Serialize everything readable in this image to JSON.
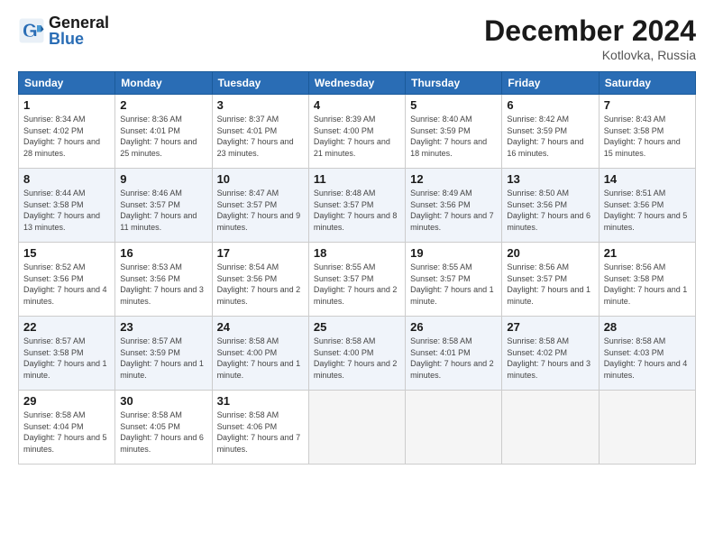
{
  "header": {
    "logo_general": "General",
    "logo_blue": "Blue",
    "month": "December 2024",
    "location": "Kotlovka, Russia"
  },
  "days_of_week": [
    "Sunday",
    "Monday",
    "Tuesday",
    "Wednesday",
    "Thursday",
    "Friday",
    "Saturday"
  ],
  "weeks": [
    {
      "shaded": false,
      "days": [
        {
          "date": "1",
          "sunrise": "8:34 AM",
          "sunset": "4:02 PM",
          "daylight": "7 hours and 28 minutes."
        },
        {
          "date": "2",
          "sunrise": "8:36 AM",
          "sunset": "4:01 PM",
          "daylight": "7 hours and 25 minutes."
        },
        {
          "date": "3",
          "sunrise": "8:37 AM",
          "sunset": "4:01 PM",
          "daylight": "7 hours and 23 minutes."
        },
        {
          "date": "4",
          "sunrise": "8:39 AM",
          "sunset": "4:00 PM",
          "daylight": "7 hours and 21 minutes."
        },
        {
          "date": "5",
          "sunrise": "8:40 AM",
          "sunset": "3:59 PM",
          "daylight": "7 hours and 18 minutes."
        },
        {
          "date": "6",
          "sunrise": "8:42 AM",
          "sunset": "3:59 PM",
          "daylight": "7 hours and 16 minutes."
        },
        {
          "date": "7",
          "sunrise": "8:43 AM",
          "sunset": "3:58 PM",
          "daylight": "7 hours and 15 minutes."
        }
      ]
    },
    {
      "shaded": true,
      "days": [
        {
          "date": "8",
          "sunrise": "8:44 AM",
          "sunset": "3:58 PM",
          "daylight": "7 hours and 13 minutes."
        },
        {
          "date": "9",
          "sunrise": "8:46 AM",
          "sunset": "3:57 PM",
          "daylight": "7 hours and 11 minutes."
        },
        {
          "date": "10",
          "sunrise": "8:47 AM",
          "sunset": "3:57 PM",
          "daylight": "7 hours and 9 minutes."
        },
        {
          "date": "11",
          "sunrise": "8:48 AM",
          "sunset": "3:57 PM",
          "daylight": "7 hours and 8 minutes."
        },
        {
          "date": "12",
          "sunrise": "8:49 AM",
          "sunset": "3:56 PM",
          "daylight": "7 hours and 7 minutes."
        },
        {
          "date": "13",
          "sunrise": "8:50 AM",
          "sunset": "3:56 PM",
          "daylight": "7 hours and 6 minutes."
        },
        {
          "date": "14",
          "sunrise": "8:51 AM",
          "sunset": "3:56 PM",
          "daylight": "7 hours and 5 minutes."
        }
      ]
    },
    {
      "shaded": false,
      "days": [
        {
          "date": "15",
          "sunrise": "8:52 AM",
          "sunset": "3:56 PM",
          "daylight": "7 hours and 4 minutes."
        },
        {
          "date": "16",
          "sunrise": "8:53 AM",
          "sunset": "3:56 PM",
          "daylight": "7 hours and 3 minutes."
        },
        {
          "date": "17",
          "sunrise": "8:54 AM",
          "sunset": "3:56 PM",
          "daylight": "7 hours and 2 minutes."
        },
        {
          "date": "18",
          "sunrise": "8:55 AM",
          "sunset": "3:57 PM",
          "daylight": "7 hours and 2 minutes."
        },
        {
          "date": "19",
          "sunrise": "8:55 AM",
          "sunset": "3:57 PM",
          "daylight": "7 hours and 1 minute."
        },
        {
          "date": "20",
          "sunrise": "8:56 AM",
          "sunset": "3:57 PM",
          "daylight": "7 hours and 1 minute."
        },
        {
          "date": "21",
          "sunrise": "8:56 AM",
          "sunset": "3:58 PM",
          "daylight": "7 hours and 1 minute."
        }
      ]
    },
    {
      "shaded": true,
      "days": [
        {
          "date": "22",
          "sunrise": "8:57 AM",
          "sunset": "3:58 PM",
          "daylight": "7 hours and 1 minute."
        },
        {
          "date": "23",
          "sunrise": "8:57 AM",
          "sunset": "3:59 PM",
          "daylight": "7 hours and 1 minute."
        },
        {
          "date": "24",
          "sunrise": "8:58 AM",
          "sunset": "4:00 PM",
          "daylight": "7 hours and 1 minute."
        },
        {
          "date": "25",
          "sunrise": "8:58 AM",
          "sunset": "4:00 PM",
          "daylight": "7 hours and 2 minutes."
        },
        {
          "date": "26",
          "sunrise": "8:58 AM",
          "sunset": "4:01 PM",
          "daylight": "7 hours and 2 minutes."
        },
        {
          "date": "27",
          "sunrise": "8:58 AM",
          "sunset": "4:02 PM",
          "daylight": "7 hours and 3 minutes."
        },
        {
          "date": "28",
          "sunrise": "8:58 AM",
          "sunset": "4:03 PM",
          "daylight": "7 hours and 4 minutes."
        }
      ]
    },
    {
      "shaded": false,
      "days": [
        {
          "date": "29",
          "sunrise": "8:58 AM",
          "sunset": "4:04 PM",
          "daylight": "7 hours and 5 minutes."
        },
        {
          "date": "30",
          "sunrise": "8:58 AM",
          "sunset": "4:05 PM",
          "daylight": "7 hours and 6 minutes."
        },
        {
          "date": "31",
          "sunrise": "8:58 AM",
          "sunset": "4:06 PM",
          "daylight": "7 hours and 7 minutes."
        },
        null,
        null,
        null,
        null
      ]
    }
  ]
}
